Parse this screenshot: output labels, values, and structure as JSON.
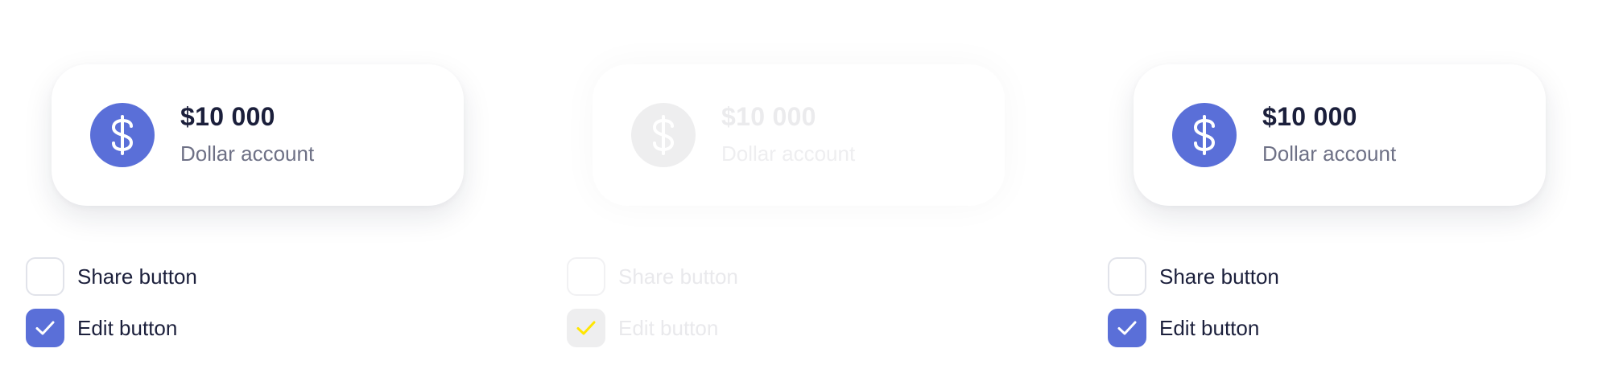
{
  "panels": [
    {
      "state": "default",
      "card": {
        "amount": "$10 000",
        "account": "Dollar account",
        "icon": "dollar-icon"
      },
      "checkboxes": [
        {
          "label": "Share button",
          "checked": false
        },
        {
          "label": "Edit button",
          "checked": true
        }
      ]
    },
    {
      "state": "disabled",
      "card": {
        "amount": "$10 000",
        "account": "Dollar account",
        "icon": "dollar-icon"
      },
      "checkboxes": [
        {
          "label": "Share button",
          "checked": false
        },
        {
          "label": "Edit button",
          "checked": true
        }
      ]
    },
    {
      "state": "default",
      "card": {
        "amount": "$10 000",
        "account": "Dollar account",
        "icon": "dollar-icon"
      },
      "checkboxes": [
        {
          "label": "Share button",
          "checked": false
        },
        {
          "label": "Edit button",
          "checked": true
        }
      ]
    }
  ],
  "colors": {
    "accent": "#5A6FD8",
    "text_primary": "#1B1F3B",
    "text_secondary": "#6E7186",
    "disabled_fill": "#EEEEEF",
    "disabled_check": "#FFE600"
  }
}
